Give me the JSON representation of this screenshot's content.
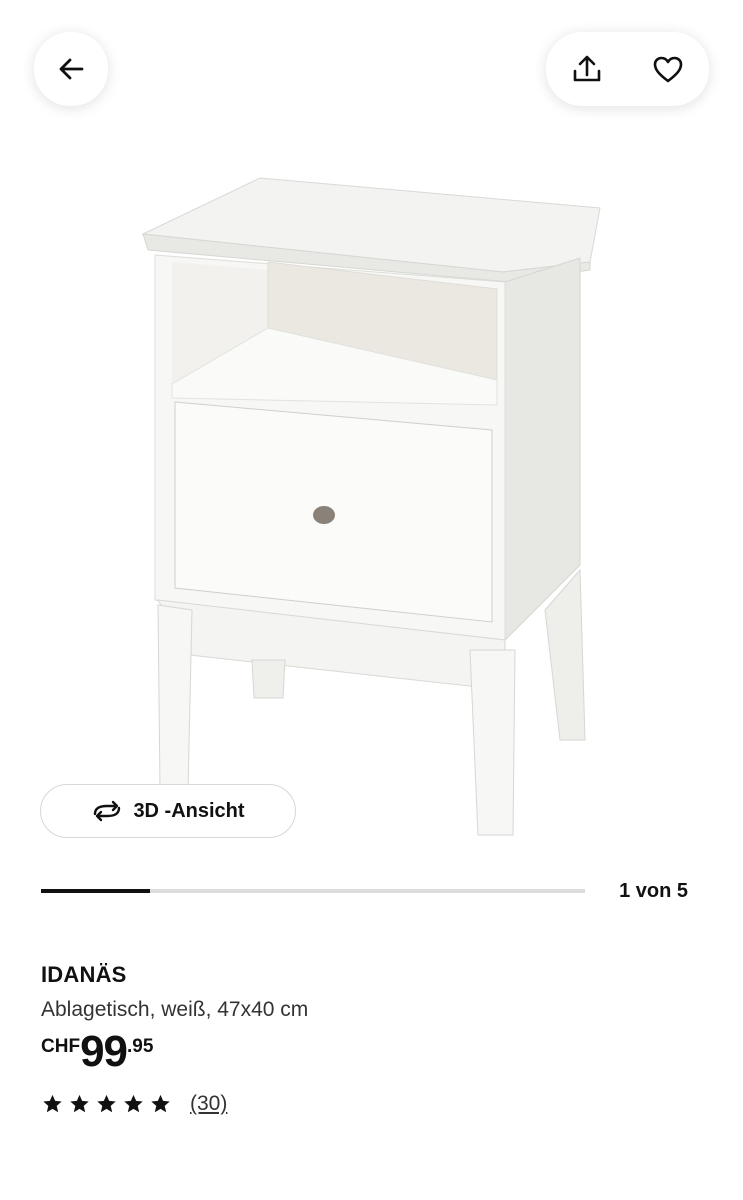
{
  "gallery": {
    "view3d_label": "3D -Ansicht",
    "counter": "1 von 5",
    "progress_fraction": 0.2
  },
  "product": {
    "name": "IDANÄS",
    "description": "Ablagetisch, weiß, 47x40 cm",
    "price": {
      "currency": "CHF",
      "integer": "99",
      "decimal": ".95"
    },
    "rating": {
      "stars": 5,
      "reviews": "(30)"
    }
  },
  "icons": {
    "back": "arrow-left-icon",
    "share": "share-icon",
    "favourite": "heart-icon",
    "view3d": "rotate-3d-icon",
    "star": "star-icon"
  }
}
